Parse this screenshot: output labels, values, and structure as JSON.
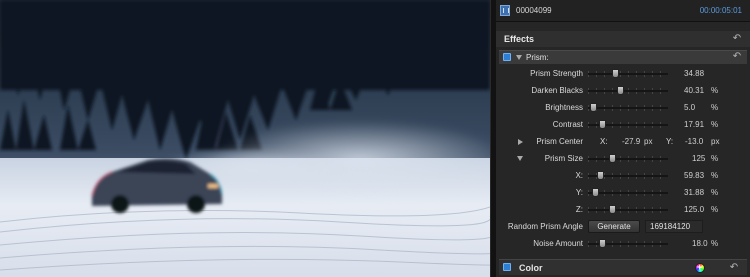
{
  "viewer": {
    "description_icon": "video-frame"
  },
  "clip": {
    "name": "00004099",
    "timecode": "00:00:05:01"
  },
  "effects": {
    "title": "Effects"
  },
  "prism": {
    "label": "Prism:",
    "params": {
      "prism_strength": {
        "label": "Prism Strength",
        "value": "34.88",
        "unit": "",
        "level": 0.35
      },
      "darken_blacks": {
        "label": "Darken Blacks",
        "value": "40.31",
        "unit": "%",
        "level": 0.4
      },
      "brightness": {
        "label": "Brightness",
        "value": "5.0",
        "unit": "%",
        "level": 0.05
      },
      "contrast": {
        "label": "Contrast",
        "value": "17.91",
        "unit": "%",
        "level": 0.18
      },
      "prism_center": {
        "label": "Prism Center",
        "x_label": "X:",
        "x_value": "-27.9",
        "x_unit": "px",
        "y_label": "Y:",
        "y_value": "-13.0",
        "y_unit": "px"
      },
      "prism_size": {
        "label": "Prism Size",
        "value": "125",
        "unit": "%",
        "level": 0.31
      },
      "x": {
        "label": "X:",
        "value": "59.83",
        "unit": "%",
        "level": 0.15
      },
      "y": {
        "label": "Y:",
        "value": "31.88",
        "unit": "%",
        "level": 0.08
      },
      "z": {
        "label": "Z:",
        "value": "125.0",
        "unit": "%",
        "level": 0.31
      },
      "random_angle": {
        "label": "Random Prism Angle",
        "button": "Generate",
        "seed": "169184120"
      },
      "noise_amount": {
        "label": "Noise Amount",
        "value": "18.0",
        "unit": "%",
        "level": 0.18
      }
    }
  },
  "color": {
    "label": "Color"
  },
  "colors": {
    "accent": "#2d7fd6",
    "timecode": "#5b9bdf",
    "panel": "#262626"
  }
}
